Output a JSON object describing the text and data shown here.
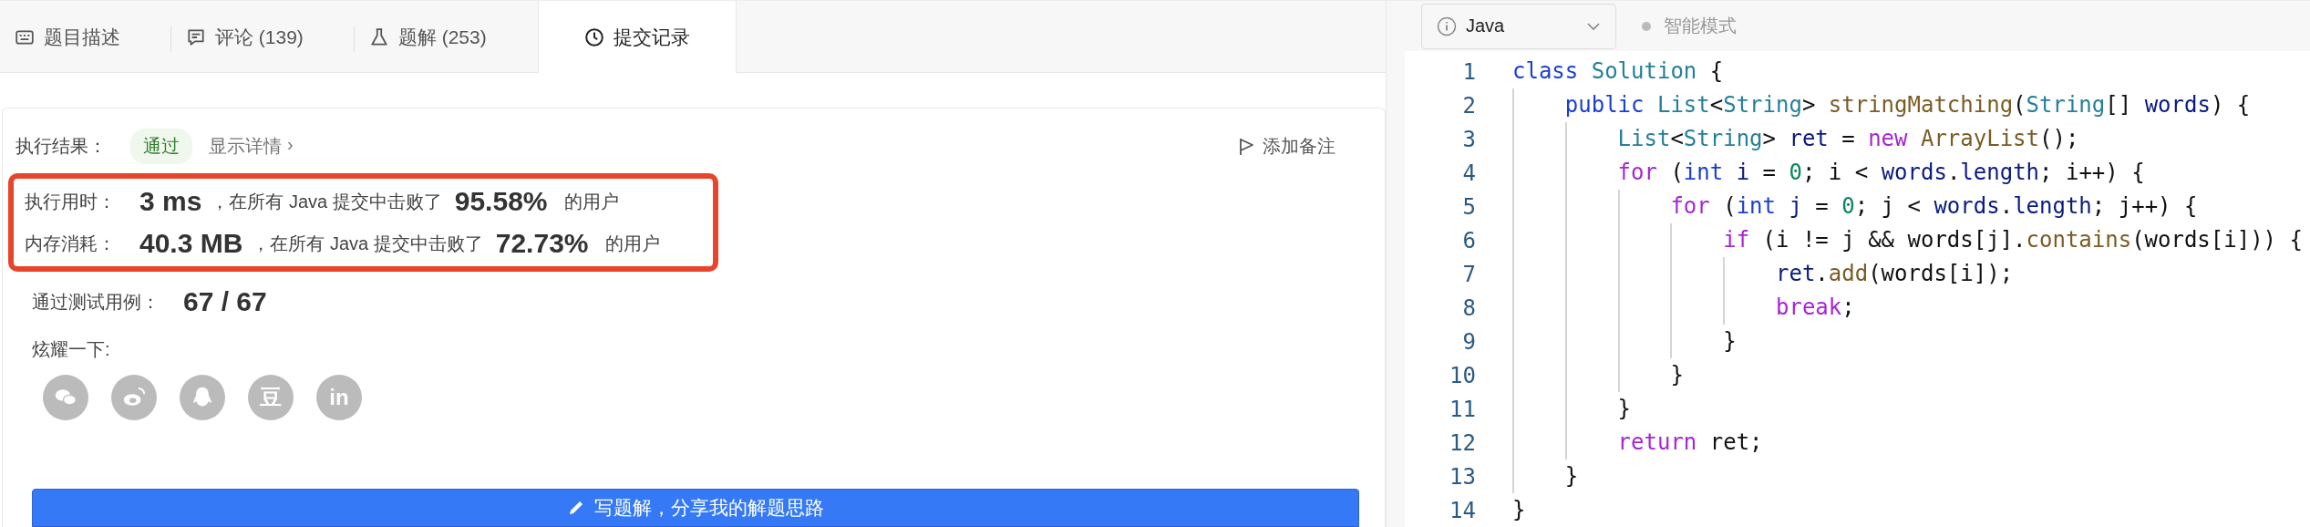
{
  "tabs": [
    {
      "kind": "description",
      "label": "题目描述",
      "selected": false
    },
    {
      "kind": "comments",
      "label": "评论 (139)",
      "selected": false
    },
    {
      "kind": "solutions",
      "label": "题解 (253)",
      "selected": false
    },
    {
      "kind": "submissions",
      "label": "提交记录",
      "selected": true
    }
  ],
  "result": {
    "label": "执行结果：",
    "status": "通过",
    "details_link": "显示详情",
    "details_chevron": "›",
    "add_note": "添加备注"
  },
  "stats": {
    "highlighted": true,
    "rows": [
      {
        "label": "执行用时：",
        "value": "3 ms",
        "middle": "，在所有 Java 提交中击败了",
        "percent": "95.58%",
        "suffix": "的用户"
      },
      {
        "label": "内存消耗：",
        "value": "40.3 MB",
        "middle": "，在所有 Java 提交中击败了",
        "percent": "72.73%",
        "suffix": "的用户"
      }
    ]
  },
  "tests": {
    "label": "通过测试用例：",
    "value": "67 / 67"
  },
  "share": {
    "label": "炫耀一下:",
    "buttons": [
      {
        "kind": "chat"
      },
      {
        "kind": "eye"
      },
      {
        "kind": "penguin"
      },
      {
        "kind": "glyph",
        "glyph": "豆"
      },
      {
        "kind": "glyph",
        "glyph": "in"
      }
    ]
  },
  "write_button": "写题解，分享我的解题思路",
  "editor": {
    "language": "Java",
    "mode": "智能模式",
    "lines": [
      {
        "number": "1",
        "tokens": [
          {
            "text": "class ",
            "kind": "keyword"
          },
          {
            "text": "Solution",
            "kind": "type"
          },
          {
            "text": " {",
            "kind": "plain"
          }
        ]
      },
      {
        "number": "2",
        "tokens": [
          {
            "text": "    public ",
            "kind": "keyword"
          },
          {
            "text": "List",
            "kind": "type"
          },
          {
            "text": "<",
            "kind": "plain"
          },
          {
            "text": "String",
            "kind": "type"
          },
          {
            "text": "> ",
            "kind": "plain"
          },
          {
            "text": "stringMatching",
            "kind": "function"
          },
          {
            "text": "(",
            "kind": "plain"
          },
          {
            "text": "String",
            "kind": "type"
          },
          {
            "text": "[] ",
            "kind": "plain"
          },
          {
            "text": "words",
            "kind": "variable"
          },
          {
            "text": ") {",
            "kind": "plain"
          }
        ]
      },
      {
        "number": "3",
        "tokens": [
          {
            "text": "        List",
            "kind": "type"
          },
          {
            "text": "<",
            "kind": "plain"
          },
          {
            "text": "String",
            "kind": "type"
          },
          {
            "text": "> ",
            "kind": "plain"
          },
          {
            "text": "ret",
            "kind": "variable"
          },
          {
            "text": " = ",
            "kind": "plain"
          },
          {
            "text": "new ",
            "kind": "control"
          },
          {
            "text": "ArrayList",
            "kind": "function"
          },
          {
            "text": "();",
            "kind": "plain"
          }
        ]
      },
      {
        "number": "4",
        "tokens": [
          {
            "text": "        for",
            "kind": "control"
          },
          {
            "text": " (",
            "kind": "plain"
          },
          {
            "text": "int ",
            "kind": "keyword"
          },
          {
            "text": "i",
            "kind": "variable"
          },
          {
            "text": " = ",
            "kind": "plain"
          },
          {
            "text": "0",
            "kind": "number"
          },
          {
            "text": "; i < ",
            "kind": "plain"
          },
          {
            "text": "words",
            "kind": "variable"
          },
          {
            "text": ".",
            "kind": "plain"
          },
          {
            "text": "length",
            "kind": "variable"
          },
          {
            "text": "; i++) {",
            "kind": "plain"
          }
        ]
      },
      {
        "number": "5",
        "tokens": [
          {
            "text": "            for",
            "kind": "control"
          },
          {
            "text": " (",
            "kind": "plain"
          },
          {
            "text": "int ",
            "kind": "keyword"
          },
          {
            "text": "j",
            "kind": "variable"
          },
          {
            "text": " = ",
            "kind": "plain"
          },
          {
            "text": "0",
            "kind": "number"
          },
          {
            "text": "; j < ",
            "kind": "plain"
          },
          {
            "text": "words",
            "kind": "variable"
          },
          {
            "text": ".",
            "kind": "plain"
          },
          {
            "text": "length",
            "kind": "variable"
          },
          {
            "text": "; j++) {",
            "kind": "plain"
          }
        ]
      },
      {
        "number": "6",
        "tokens": [
          {
            "text": "                if",
            "kind": "control"
          },
          {
            "text": " (i != j && words[j].",
            "kind": "plain"
          },
          {
            "text": "contains",
            "kind": "function"
          },
          {
            "text": "(words[i])) {",
            "kind": "plain"
          }
        ]
      },
      {
        "number": "7",
        "tokens": [
          {
            "text": "                    ret",
            "kind": "variable"
          },
          {
            "text": ".",
            "kind": "plain"
          },
          {
            "text": "add",
            "kind": "function"
          },
          {
            "text": "(words[i]);",
            "kind": "plain"
          }
        ]
      },
      {
        "number": "8",
        "tokens": [
          {
            "text": "                    break",
            "kind": "control"
          },
          {
            "text": ";",
            "kind": "plain"
          }
        ]
      },
      {
        "number": "9",
        "tokens": [
          {
            "text": "                }",
            "kind": "plain"
          }
        ]
      },
      {
        "number": "10",
        "tokens": [
          {
            "text": "            }",
            "kind": "plain"
          }
        ]
      },
      {
        "number": "11",
        "tokens": [
          {
            "text": "        }",
            "kind": "plain"
          }
        ]
      },
      {
        "number": "12",
        "tokens": [
          {
            "text": "        return",
            "kind": "control"
          },
          {
            "text": " ret;",
            "kind": "plain"
          }
        ]
      },
      {
        "number": "13",
        "tokens": [
          {
            "text": "    }",
            "kind": "plain"
          }
        ]
      },
      {
        "number": "14",
        "tokens": [
          {
            "text": "}",
            "kind": "plain"
          }
        ]
      }
    ]
  }
}
